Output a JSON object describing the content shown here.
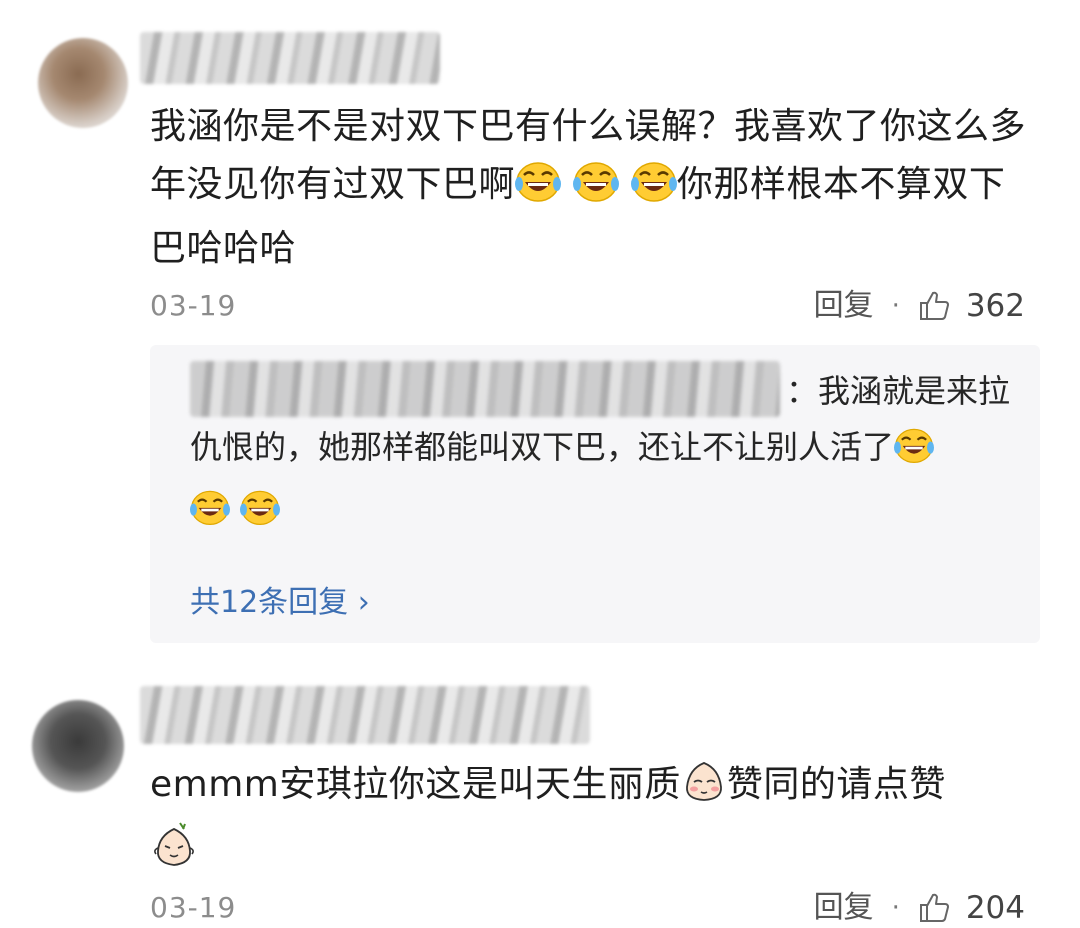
{
  "comments": [
    {
      "text_parts": [
        " 我涵你是不是对双下巴有什么误解？我喜欢了你这么多年没见你有过双下巴啊",
        "你那样根本不算双下巴哈哈哈"
      ],
      "date": "03-19",
      "reply_label": "回复",
      "separator": "·",
      "likes": "362",
      "reply_preview": {
        "text_parts": [
          "：我涵就是来拉仇恨的，她那样都能叫双下巴，还让不让别人活了"
        ],
        "more_label": "共12条回复 ›"
      }
    },
    {
      "text_parts": [
        "emmm安琪拉你这是叫天生丽质",
        "赞同的请点赞"
      ],
      "date": "03-19",
      "reply_label": "回复",
      "separator": "·",
      "likes": "204"
    }
  ],
  "icons": {
    "laugh_cry": "laughing-crying-face-icon",
    "shy_sticker": "shy-face-sticker-icon",
    "like": "thumbs-up-icon"
  },
  "colors": {
    "link": "#3d6fb3",
    "reply_bg": "#f6f6f8",
    "muted": "#8c8c8c"
  }
}
